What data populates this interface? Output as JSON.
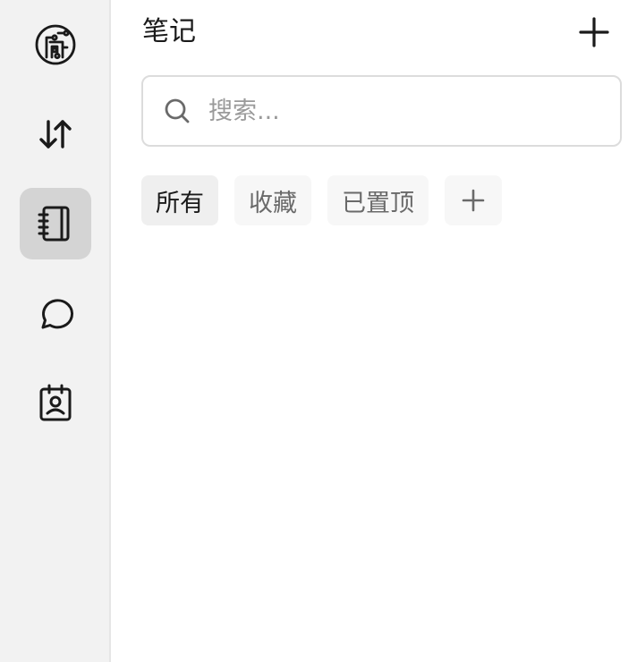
{
  "sidebar": {
    "items": [
      {
        "name": "logo-icon",
        "active": false
      },
      {
        "name": "transfer-arrows-icon",
        "active": false
      },
      {
        "name": "notebook-icon",
        "active": true
      },
      {
        "name": "chat-bubble-icon",
        "active": false
      },
      {
        "name": "contact-card-icon",
        "active": false
      }
    ]
  },
  "header": {
    "title": "笔记",
    "add_icon": "plus-icon"
  },
  "search": {
    "placeholder": "搜索...",
    "value": "",
    "icon": "search-icon"
  },
  "tabs": [
    {
      "label": "所有",
      "active": true
    },
    {
      "label": "收藏",
      "active": false
    },
    {
      "label": "已置顶",
      "active": false
    }
  ],
  "add_tab_icon": "plus-icon",
  "colors": {
    "sidebar_bg": "#f2f2f2",
    "active_nav_bg": "#d4d4d4",
    "text": "#1a1a1a",
    "muted_text": "#6a6a6a"
  }
}
